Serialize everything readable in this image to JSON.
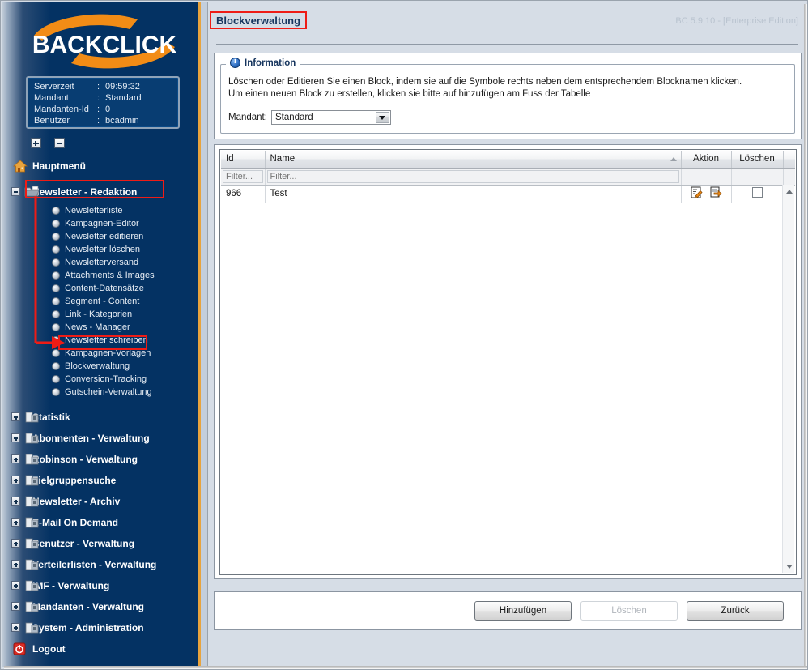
{
  "app": {
    "logo_text": "BACKCLICK",
    "version": "BC 5.9.10 - [Enterprise Edition]"
  },
  "server_info": {
    "rows": [
      {
        "key": "Serverzeit",
        "sep": ":",
        "value": "09:59:32"
      },
      {
        "key": "Mandant",
        "sep": ":",
        "value": "Standard"
      },
      {
        "key": "Mandanten-Id",
        "sep": ":",
        "value": "0"
      },
      {
        "key": "Benutzer",
        "sep": ":",
        "value": "bcadmin"
      }
    ]
  },
  "sidebar": {
    "expand_all_title": "+",
    "collapse_all_title": "-",
    "home": {
      "label": "Hauptmenü",
      "icon": "house-icon"
    },
    "open_group": {
      "label": "Newsletter - Redaktion",
      "icon": "folder-open-icon",
      "state": "expanded",
      "items": [
        {
          "label": "Newsletterliste"
        },
        {
          "label": "Kampagnen-Editor"
        },
        {
          "label": "Newsletter editieren"
        },
        {
          "label": "Newsletter löschen"
        },
        {
          "label": "Newsletterversand"
        },
        {
          "label": "Attachments & Images"
        },
        {
          "label": "Content-Datensätze"
        },
        {
          "label": "Segment - Content"
        },
        {
          "label": "Link - Kategorien"
        },
        {
          "label": "News - Manager"
        },
        {
          "label": "Newsletter schreiben"
        },
        {
          "label": "Kampagnen-Vorlagen"
        },
        {
          "label": "Blockverwaltung",
          "highlighted": true
        },
        {
          "label": "Conversion-Tracking"
        },
        {
          "label": "Gutschein-Verwaltung"
        }
      ]
    },
    "groups": [
      {
        "label": "Statistik"
      },
      {
        "label": "Abonnenten - Verwaltung"
      },
      {
        "label": "Robinson - Verwaltung"
      },
      {
        "label": "Zielgruppensuche"
      },
      {
        "label": "Newsletter - Archiv"
      },
      {
        "label": "E-Mail On Demand"
      },
      {
        "label": "Benutzer - Verwaltung"
      },
      {
        "label": "Verteilerlisten - Verwaltung"
      },
      {
        "label": "IMF - Verwaltung"
      },
      {
        "label": "Mandanten - Verwaltung"
      },
      {
        "label": "System - Administration"
      }
    ],
    "logout": {
      "label": "Logout",
      "icon": "power-icon"
    }
  },
  "page": {
    "title": "Blockverwaltung"
  },
  "information": {
    "legend": "Information",
    "line1": "Löschen oder Editieren Sie einen Block, indem sie auf die Symbole rechts neben dem entsprechendem Blocknamen klicken.",
    "line2": "Um einen neuen Block zu erstellen, klicken sie bitte auf hinzufügen am Fuss der Tabelle",
    "mandant_label": "Mandant:",
    "mandant_value": "Standard",
    "mandant_options": [
      "Standard"
    ]
  },
  "grid": {
    "columns": [
      {
        "key": "id",
        "label": "Id"
      },
      {
        "key": "name",
        "label": "Name",
        "sorted": "asc"
      },
      {
        "key": "aktion",
        "label": "Aktion"
      },
      {
        "key": "delete",
        "label": "Löschen"
      }
    ],
    "filter_placeholder": "Filter...",
    "filters": {
      "id": "",
      "name": ""
    },
    "rows": [
      {
        "id": "966",
        "name": "Test",
        "edit_icon": "edit-pencil-icon",
        "copy_icon": "copy-icon",
        "delete_checked": false
      }
    ]
  },
  "footer": {
    "add_label": "Hinzufügen",
    "delete_label": "Löschen",
    "back_label": "Zurück",
    "delete_disabled": true
  },
  "colors": {
    "sidebar_navy": "#043263",
    "accent_orange": "#e8a33d",
    "annotation_red": "#ee1c16",
    "content_bg": "#d6dde6",
    "title_blue": "#17365e"
  }
}
